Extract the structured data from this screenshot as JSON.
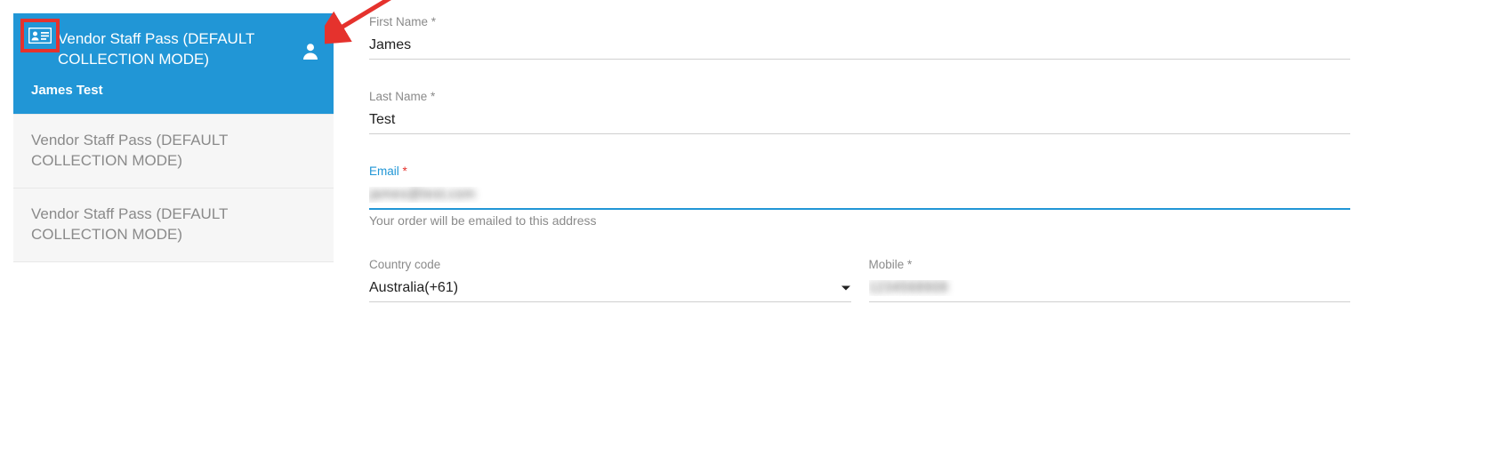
{
  "sidebar": {
    "items": [
      {
        "title": "Vendor Staff Pass (DEFAULT COLLECTION MODE)",
        "subtitle": "James Test",
        "active": true
      },
      {
        "title": "Vendor Staff Pass (DEFAULT COLLECTION MODE)",
        "active": false
      },
      {
        "title": "Vendor Staff Pass (DEFAULT COLLECTION MODE)",
        "active": false
      }
    ]
  },
  "form": {
    "first_name": {
      "label": "First Name *",
      "value": "James"
    },
    "last_name": {
      "label": "Last Name *",
      "value": "Test"
    },
    "email": {
      "label": "Email",
      "req": "*",
      "value": "james@test.com",
      "help": "Your order will be emailed to this address"
    },
    "country_code": {
      "label": "Country code",
      "value": "Australia(+61)"
    },
    "mobile": {
      "label": "Mobile *",
      "value": "1234568908"
    }
  },
  "colors": {
    "primary": "#2196d6",
    "accent_red": "#e5322d",
    "muted_text": "#8a8a8a"
  }
}
